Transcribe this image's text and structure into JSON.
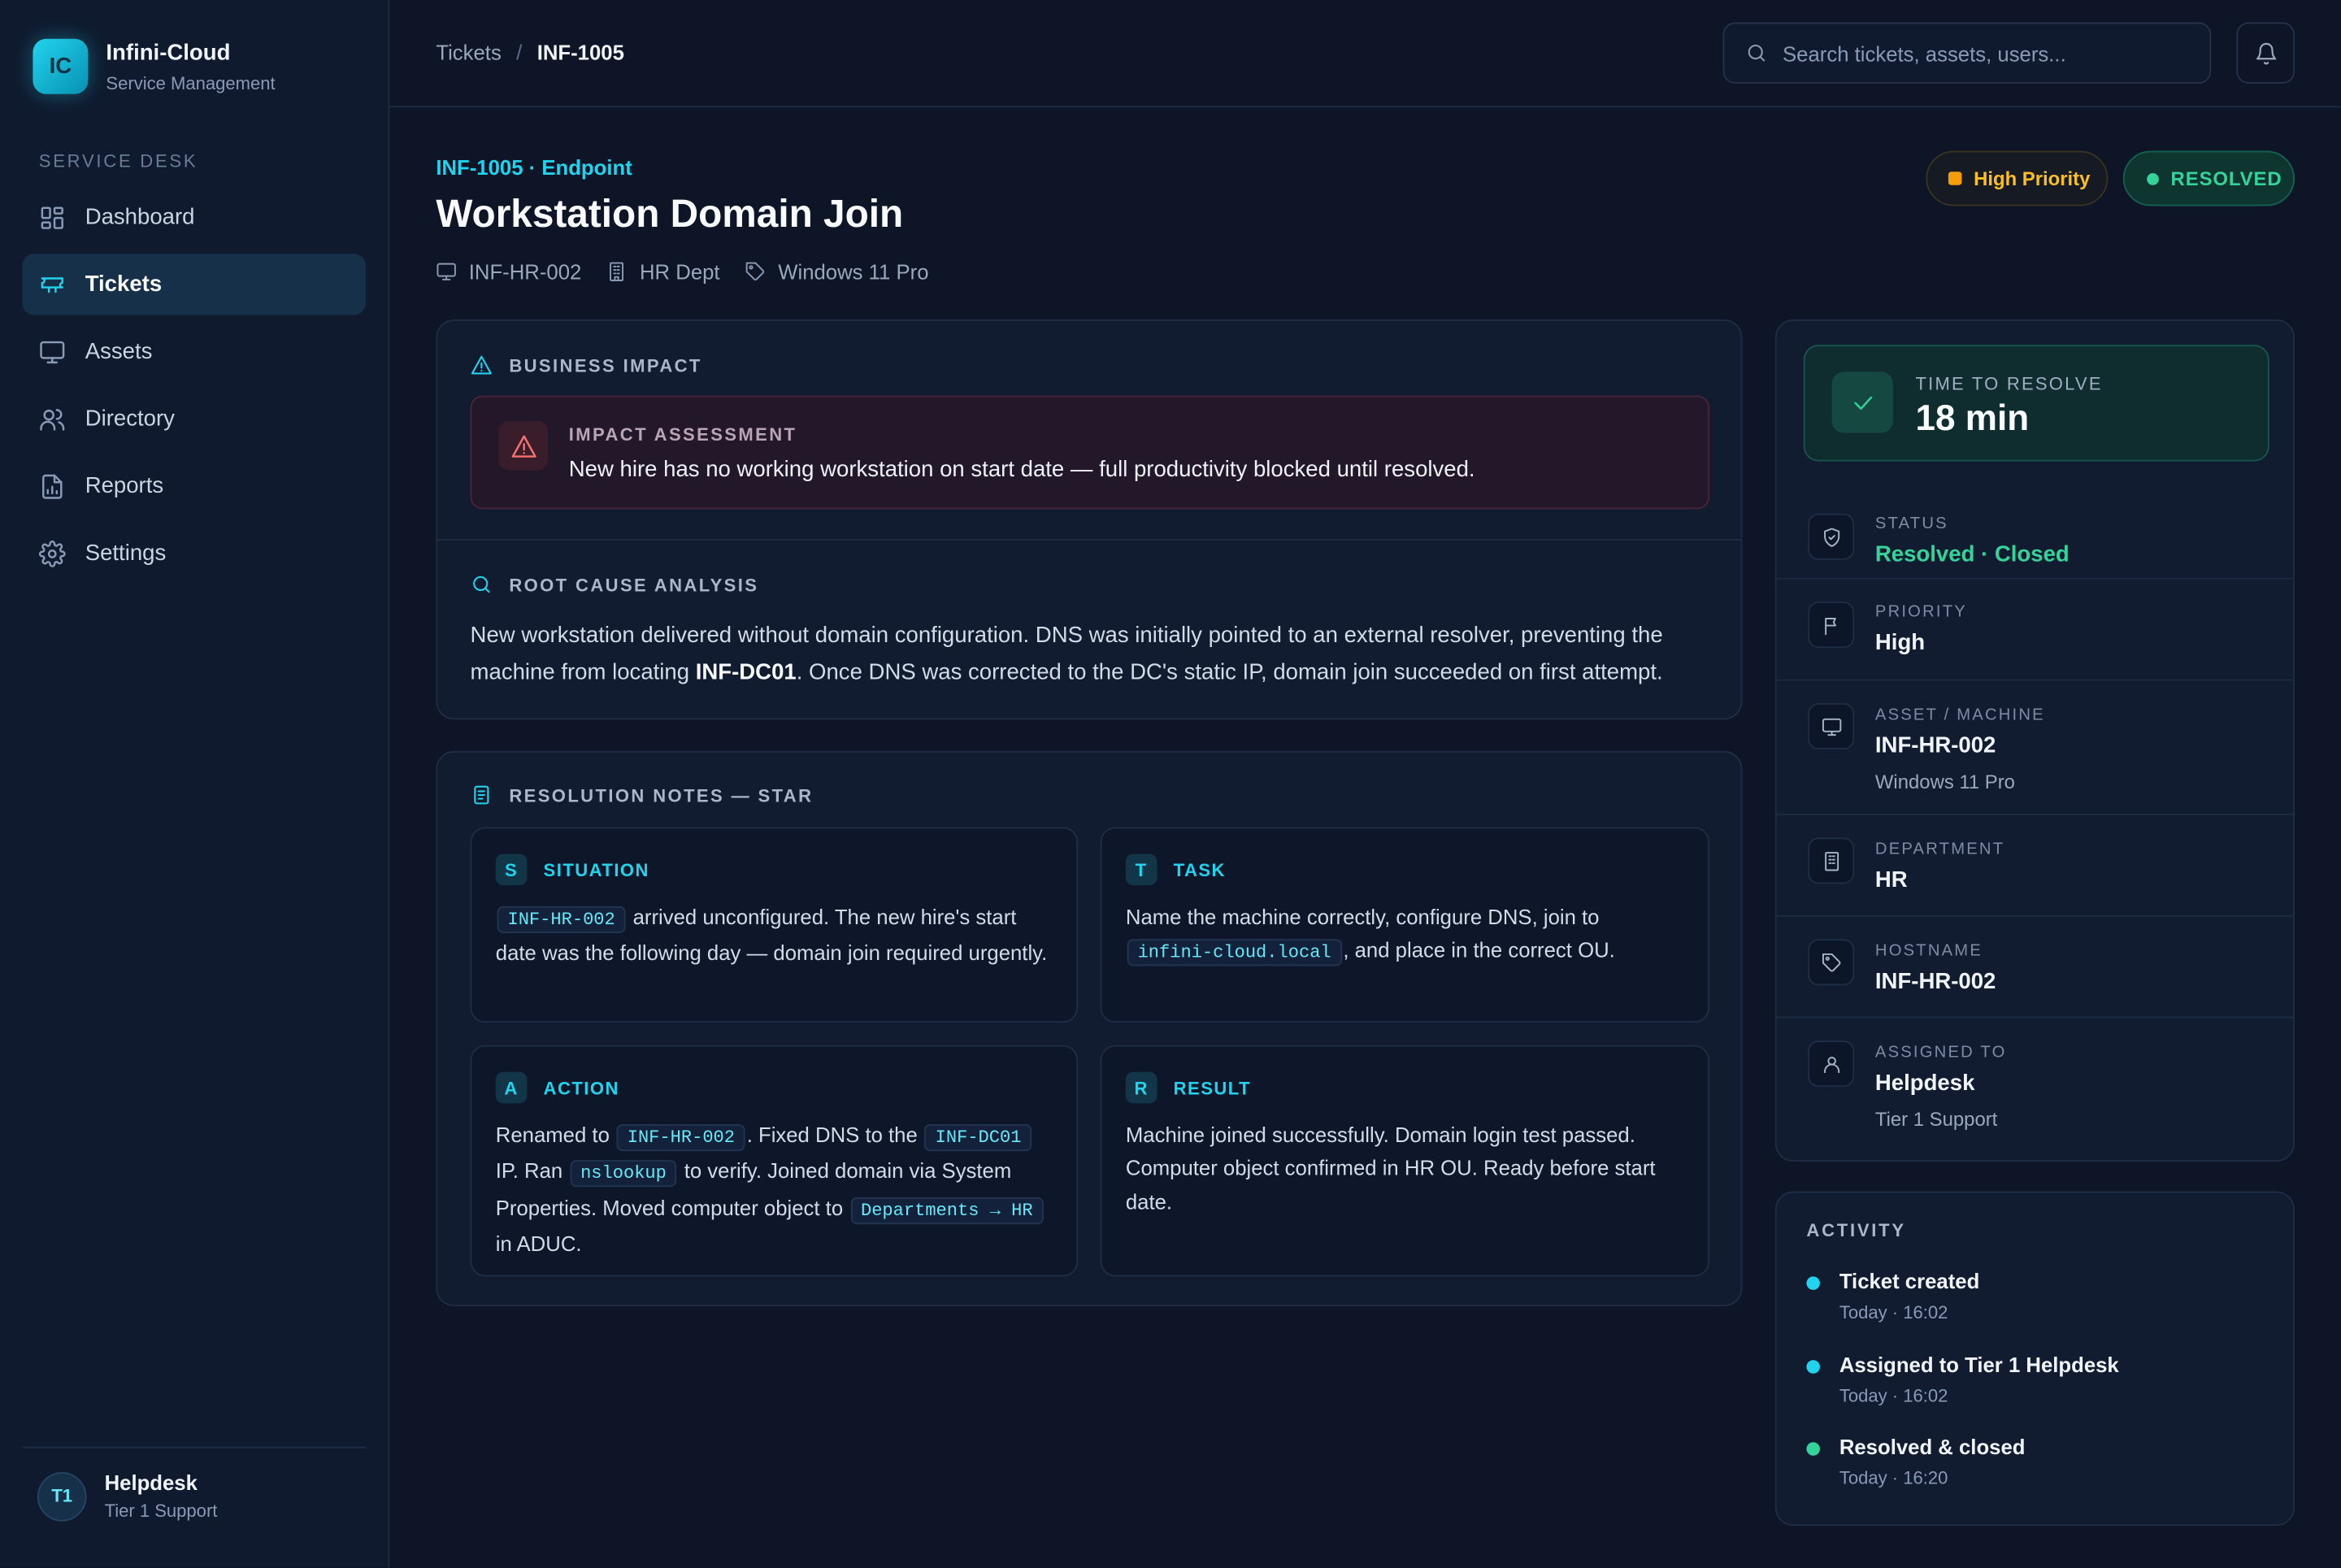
{
  "brand": {
    "logo": "IC",
    "name": "Infini-Cloud",
    "subtitle": "Service Management"
  },
  "sidebar": {
    "section_label": "SERVICE DESK",
    "items": [
      {
        "label": "Dashboard",
        "icon": "grid-icon",
        "active": false
      },
      {
        "label": "Tickets",
        "icon": "ticket-icon",
        "active": true
      },
      {
        "label": "Assets",
        "icon": "monitor-icon",
        "active": false
      },
      {
        "label": "Directory",
        "icon": "users-icon",
        "active": false
      },
      {
        "label": "Reports",
        "icon": "file-chart-icon",
        "active": false
      },
      {
        "label": "Settings",
        "icon": "gear-icon",
        "active": false
      }
    ],
    "user": {
      "initials": "T1",
      "name": "Helpdesk",
      "role": "Tier 1 Support"
    }
  },
  "topbar": {
    "breadcrumb": [
      "Tickets",
      "INF-1005"
    ],
    "search_placeholder": "Search tickets, assets, users..."
  },
  "ticket": {
    "kicker": "INF-1005 · Endpoint",
    "title": "Workstation Domain Join",
    "meta": [
      {
        "icon": "monitor-icon",
        "label": "INF-HR-002"
      },
      {
        "icon": "building-icon",
        "label": "HR Dept"
      },
      {
        "icon": "tag-icon",
        "label": "Windows 11 Pro"
      }
    ],
    "priority_pill": "High Priority",
    "status_pill": "RESOLVED"
  },
  "business_impact": {
    "heading": "BUSINESS IMPACT",
    "label": "IMPACT ASSESSMENT",
    "text": "New hire has no working workstation on start date — full productivity blocked until resolved."
  },
  "root_cause": {
    "heading": "ROOT CAUSE ANALYSIS",
    "before": "New workstation delivered without domain configuration. DNS was initially pointed to an external resolver, preventing the machine from locating ",
    "bold": "INF-DC01",
    "after": ". Once DNS was corrected to the DC's static IP, domain join succeeded on first attempt."
  },
  "resolution": {
    "heading": "RESOLUTION NOTES — STAR",
    "situation": {
      "letter": "S",
      "title": "SITUATION",
      "code1": "INF-HR-002",
      "text1": " arrived unconfigured. The new hire's start date was the following day — domain join required urgently."
    },
    "task": {
      "letter": "T",
      "title": "TASK",
      "text1": "Name the machine correctly, configure DNS, join to ",
      "code1": "infini-cloud.local",
      "text2": ", and place in the correct OU."
    },
    "action": {
      "letter": "A",
      "title": "ACTION",
      "text1": "Renamed to ",
      "code1": "INF-HR-002",
      "text2": ". Fixed DNS to the ",
      "code2": "INF-DC01",
      "text3": " IP. Ran ",
      "code3": "nslookup",
      "text4": " to verify. Joined domain via System Properties. Moved computer object to ",
      "code4": "Departments → HR",
      "text5": " in ADUC."
    },
    "result": {
      "letter": "R",
      "title": "RESULT",
      "text1": "Machine joined successfully. Domain login test passed. Computer object confirmed in HR OU. Ready before start date."
    }
  },
  "details": {
    "time_to_resolve": {
      "label": "TIME TO RESOLVE",
      "value": "18 min"
    },
    "status": {
      "label": "STATUS",
      "value": "Resolved · Closed"
    },
    "priority": {
      "label": "PRIORITY",
      "value": "High"
    },
    "asset": {
      "label": "ASSET / MACHINE",
      "value": "INF-HR-002",
      "sub": "Windows 11 Pro"
    },
    "department": {
      "label": "DEPARTMENT",
      "value": "HR"
    },
    "hostname": {
      "label": "HOSTNAME",
      "value": "INF-HR-002"
    },
    "assigned": {
      "label": "ASSIGNED TO",
      "value": "Helpdesk",
      "sub": "Tier 1 Support"
    }
  },
  "activity": {
    "heading": "ACTIVITY",
    "events": [
      {
        "title": "Ticket created",
        "time": "Today · 16:02",
        "color": "#22d3ee"
      },
      {
        "title": "Assigned to Tier 1 Helpdesk",
        "time": "Today · 16:02",
        "color": "#22d3ee"
      },
      {
        "title": "Resolved & closed",
        "time": "Today · 16:20",
        "color": "#34d399"
      }
    ]
  },
  "colors": {
    "accent": "#22d3ee",
    "success": "#34d399",
    "warning": "#f59e0b",
    "danger": "#f87171",
    "background": "#0d1526"
  }
}
